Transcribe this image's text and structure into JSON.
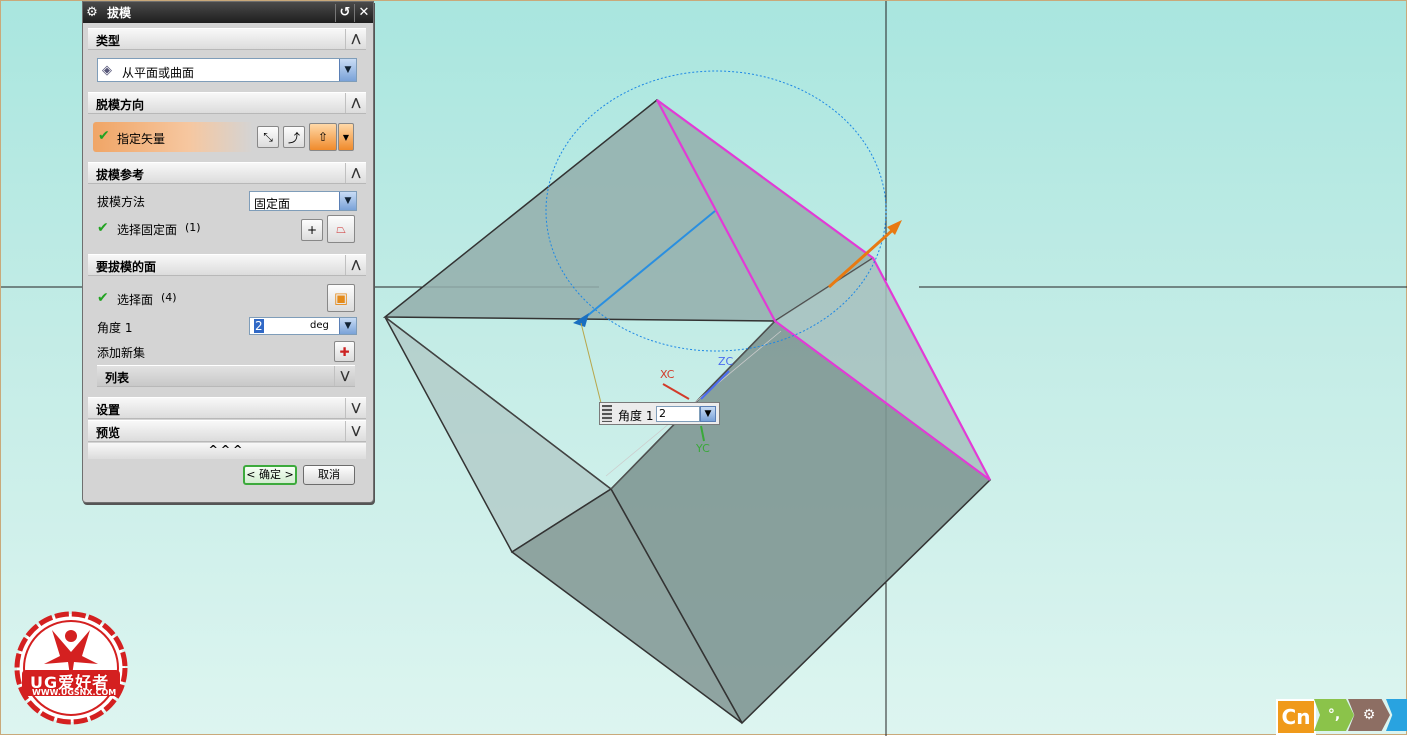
{
  "dialog": {
    "title": "拔模",
    "gear_icon": "gear-icon",
    "reset_icon": "reset-icon",
    "close_icon": "close-icon",
    "type": {
      "header": "类型",
      "combo_value": "从平面或曲面"
    },
    "direction": {
      "header": "脱模方向",
      "specify_vector": "指定矢量"
    },
    "reference": {
      "header": "拔模参考",
      "method_label": "拔模方法",
      "method_value": "固定面",
      "select_fixed_face": "选择固定面",
      "fixed_count": "(1)"
    },
    "faces": {
      "header": "要拔模的面",
      "select_face": "选择面",
      "face_count": "(4)",
      "angle_label": "角度 1",
      "angle_value": "2",
      "angle_unit": "deg",
      "add_new_set": "添加新集",
      "list_label": "列表"
    },
    "settings_header": "设置",
    "preview_header": "预览",
    "more_chevrons": "^^^",
    "ok_label": "< 确定 >",
    "cancel_label": "取消"
  },
  "float_input": {
    "label": "角度 1",
    "value": "2"
  },
  "axis_labels": {
    "xc": "XC",
    "yc": "YC",
    "zc": "ZC"
  },
  "colors": {
    "edge_highlight": "#e23bd6",
    "vector_arrow": "#e87a12",
    "selection_dash": "#1e88e5",
    "check": "#22a322"
  },
  "logo": {
    "text": "UG爱好者",
    "url": "WWW.UGSNX.COM"
  },
  "ime_bar": {
    "lang": "Cn",
    "punct": "°,",
    "settings_icon": "settings-icon"
  }
}
